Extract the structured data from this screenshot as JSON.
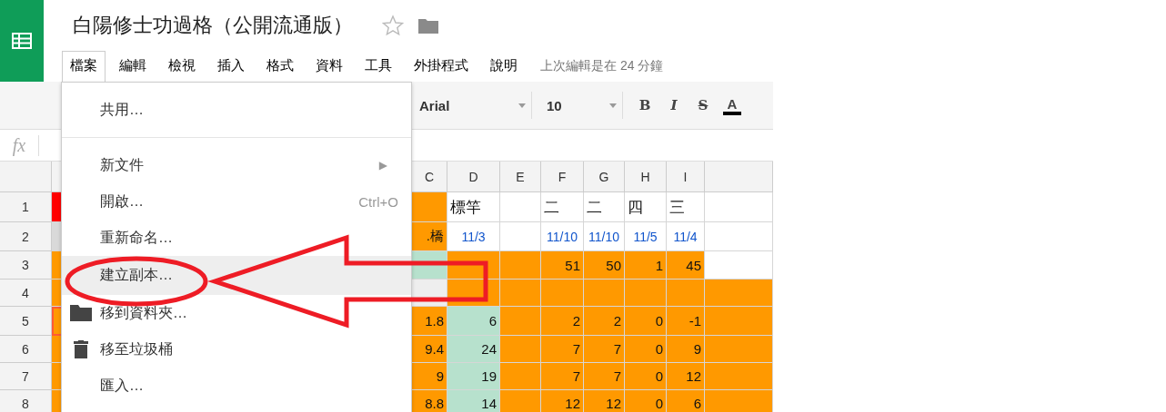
{
  "app": {
    "title": "白陽修士功過格（公開流通版）",
    "starred": false
  },
  "menu_bar": [
    {
      "label": "檔案",
      "selected": true
    },
    {
      "label": "編輯",
      "selected": false
    },
    {
      "label": "檢視",
      "selected": false
    },
    {
      "label": "插入",
      "selected": false
    },
    {
      "label": "格式",
      "selected": false
    },
    {
      "label": "資料",
      "selected": false
    },
    {
      "label": "工具",
      "selected": false
    },
    {
      "label": "外掛程式",
      "selected": false
    },
    {
      "label": "說明",
      "selected": false
    }
  ],
  "last_edit": "上次編輯是在 24 分鐘",
  "toolbar": {
    "font": "Arial",
    "font_size": "10",
    "buttons": [
      {
        "kind": "bold",
        "label": "B"
      },
      {
        "kind": "italic",
        "label": "I"
      },
      {
        "kind": "strike",
        "label": "S"
      },
      {
        "kind": "color",
        "label": "A"
      }
    ]
  },
  "formula_bar": {
    "label": "fx"
  },
  "columns": [
    "C",
    "D",
    "E",
    "F",
    "G",
    "H",
    "I"
  ],
  "rows": [
    {
      "number": "1",
      "a_cell": {
        "color": "#ff0000",
        "selected": false
      },
      "cells": [
        {
          "text": "",
          "color": "#ff9900",
          "kind": "text"
        },
        {
          "text": "標竿",
          "color": "#ffffff",
          "kind": "text"
        },
        {
          "text": "",
          "color": "#ffffff",
          "kind": "text"
        },
        {
          "text": "二",
          "color": "#ffffff",
          "kind": "text"
        },
        {
          "text": "二",
          "color": "#ffffff",
          "kind": "text"
        },
        {
          "text": "四",
          "color": "#ffffff",
          "kind": "text"
        },
        {
          "text": "三",
          "color": "#ffffff",
          "kind": "text"
        },
        {
          "text": "",
          "color": "#ffffff",
          "kind": "text"
        }
      ]
    },
    {
      "number": "2",
      "a_cell": {
        "color": "#d9d9d9",
        "selected": false
      },
      "cells": [
        {
          "text": ".橋",
          "color": "#ff9900",
          "kind": "number"
        },
        {
          "text": "11/3",
          "color": "#ffffff",
          "kind": "date"
        },
        {
          "text": "",
          "color": "#ffffff",
          "kind": "date"
        },
        {
          "text": "11/10",
          "color": "#ffffff",
          "kind": "date"
        },
        {
          "text": "11/10",
          "color": "#ffffff",
          "kind": "date"
        },
        {
          "text": "11/5",
          "color": "#ffffff",
          "kind": "date"
        },
        {
          "text": "11/4",
          "color": "#ffffff",
          "kind": "date"
        },
        {
          "text": "",
          "color": "#ffffff",
          "kind": "date"
        }
      ]
    },
    {
      "number": "3",
      "a_cell": {
        "color": "#ff9900",
        "selected": false
      },
      "cells": [
        {
          "text": "",
          "color": "#b7e1cd",
          "kind": "number"
        },
        {
          "text": "",
          "color": "#ff9900",
          "kind": "number"
        },
        {
          "text": "",
          "color": "#ff9900",
          "kind": "number"
        },
        {
          "text": "51",
          "color": "#ff9900",
          "kind": "number"
        },
        {
          "text": "50",
          "color": "#ff9900",
          "kind": "number"
        },
        {
          "text": "1",
          "color": "#ff9900",
          "kind": "number"
        },
        {
          "text": "45",
          "color": "#ff9900",
          "kind": "number"
        },
        {
          "text": "",
          "color": "#ffffff",
          "kind": "number"
        }
      ]
    },
    {
      "number": "4",
      "a_cell": {
        "color": "#ff9900",
        "selected": false
      },
      "cells": [
        {
          "text": "",
          "color": "#eeeeee",
          "kind": "number"
        },
        {
          "text": "",
          "color": "#ff9900",
          "kind": "number"
        },
        {
          "text": "",
          "color": "#ff9900",
          "kind": "number"
        },
        {
          "text": "",
          "color": "#ff9900",
          "kind": "number"
        },
        {
          "text": "",
          "color": "#ff9900",
          "kind": "number"
        },
        {
          "text": "",
          "color": "#ff9900",
          "kind": "number"
        },
        {
          "text": "",
          "color": "#ff9900",
          "kind": "number"
        },
        {
          "text": "",
          "color": "#ff9900",
          "kind": "number"
        }
      ]
    },
    {
      "number": "5",
      "a_cell": {
        "color": "#ff9900",
        "selected": true
      },
      "cells": [
        {
          "text": "1.8",
          "color": "#ff9900",
          "kind": "number"
        },
        {
          "text": "6",
          "color": "#b7e1cd",
          "kind": "number"
        },
        {
          "text": "",
          "color": "#ff9900",
          "kind": "number"
        },
        {
          "text": "2",
          "color": "#ff9900",
          "kind": "number"
        },
        {
          "text": "2",
          "color": "#ff9900",
          "kind": "number"
        },
        {
          "text": "0",
          "color": "#ff9900",
          "kind": "number"
        },
        {
          "text": "-1",
          "color": "#ff9900",
          "kind": "number"
        },
        {
          "text": "",
          "color": "#ff9900",
          "kind": "number"
        }
      ]
    },
    {
      "number": "6",
      "a_cell": {
        "color": "#ff9900",
        "selected": false
      },
      "cells": [
        {
          "text": "9.4",
          "color": "#ff9900",
          "kind": "number"
        },
        {
          "text": "24",
          "color": "#b7e1cd",
          "kind": "number"
        },
        {
          "text": "",
          "color": "#ff9900",
          "kind": "number"
        },
        {
          "text": "7",
          "color": "#ff9900",
          "kind": "number"
        },
        {
          "text": "7",
          "color": "#ff9900",
          "kind": "number"
        },
        {
          "text": "0",
          "color": "#ff9900",
          "kind": "number"
        },
        {
          "text": "9",
          "color": "#ff9900",
          "kind": "number"
        },
        {
          "text": "",
          "color": "#ff9900",
          "kind": "number"
        }
      ]
    },
    {
      "number": "7",
      "a_cell": {
        "color": "#ff9900",
        "selected": false
      },
      "cells": [
        {
          "text": "9",
          "color": "#ff9900",
          "kind": "number"
        },
        {
          "text": "19",
          "color": "#b7e1cd",
          "kind": "number"
        },
        {
          "text": "",
          "color": "#ff9900",
          "kind": "number"
        },
        {
          "text": "7",
          "color": "#ff9900",
          "kind": "number"
        },
        {
          "text": "7",
          "color": "#ff9900",
          "kind": "number"
        },
        {
          "text": "0",
          "color": "#ff9900",
          "kind": "number"
        },
        {
          "text": "12",
          "color": "#ff9900",
          "kind": "number"
        },
        {
          "text": "",
          "color": "#ff9900",
          "kind": "number"
        }
      ]
    },
    {
      "number": "8",
      "a_cell": {
        "color": "#ff9900",
        "selected": false
      },
      "cells": [
        {
          "text": "8.8",
          "color": "#ff9900",
          "kind": "number"
        },
        {
          "text": "14",
          "color": "#b7e1cd",
          "kind": "number"
        },
        {
          "text": "",
          "color": "#ff9900",
          "kind": "number"
        },
        {
          "text": "12",
          "color": "#ff9900",
          "kind": "number"
        },
        {
          "text": "12",
          "color": "#ff9900",
          "kind": "number"
        },
        {
          "text": "0",
          "color": "#ff9900",
          "kind": "number"
        },
        {
          "text": "6",
          "color": "#ff9900",
          "kind": "number"
        },
        {
          "text": "",
          "color": "#ff9900",
          "kind": "number"
        }
      ]
    }
  ],
  "file_menu": [
    {
      "kind": "plain",
      "label": "共用…",
      "selected": false
    },
    {
      "kind": "divider"
    },
    {
      "kind": "submenu",
      "label": "新文件",
      "arrow": "▶",
      "selected": false
    },
    {
      "kind": "plain",
      "label": "開啟…",
      "shortcut": "Ctrl+O",
      "selected": false
    },
    {
      "kind": "plain",
      "label": "重新命名…",
      "selected": false
    },
    {
      "kind": "plain",
      "label": "建立副本…",
      "selected": true
    },
    {
      "kind": "folder",
      "label": "移到資料夾…",
      "selected": false
    },
    {
      "kind": "trash",
      "label": "移至垃圾桶",
      "selected": false
    },
    {
      "kind": "plain",
      "label": "匯入…",
      "selected": false
    }
  ]
}
